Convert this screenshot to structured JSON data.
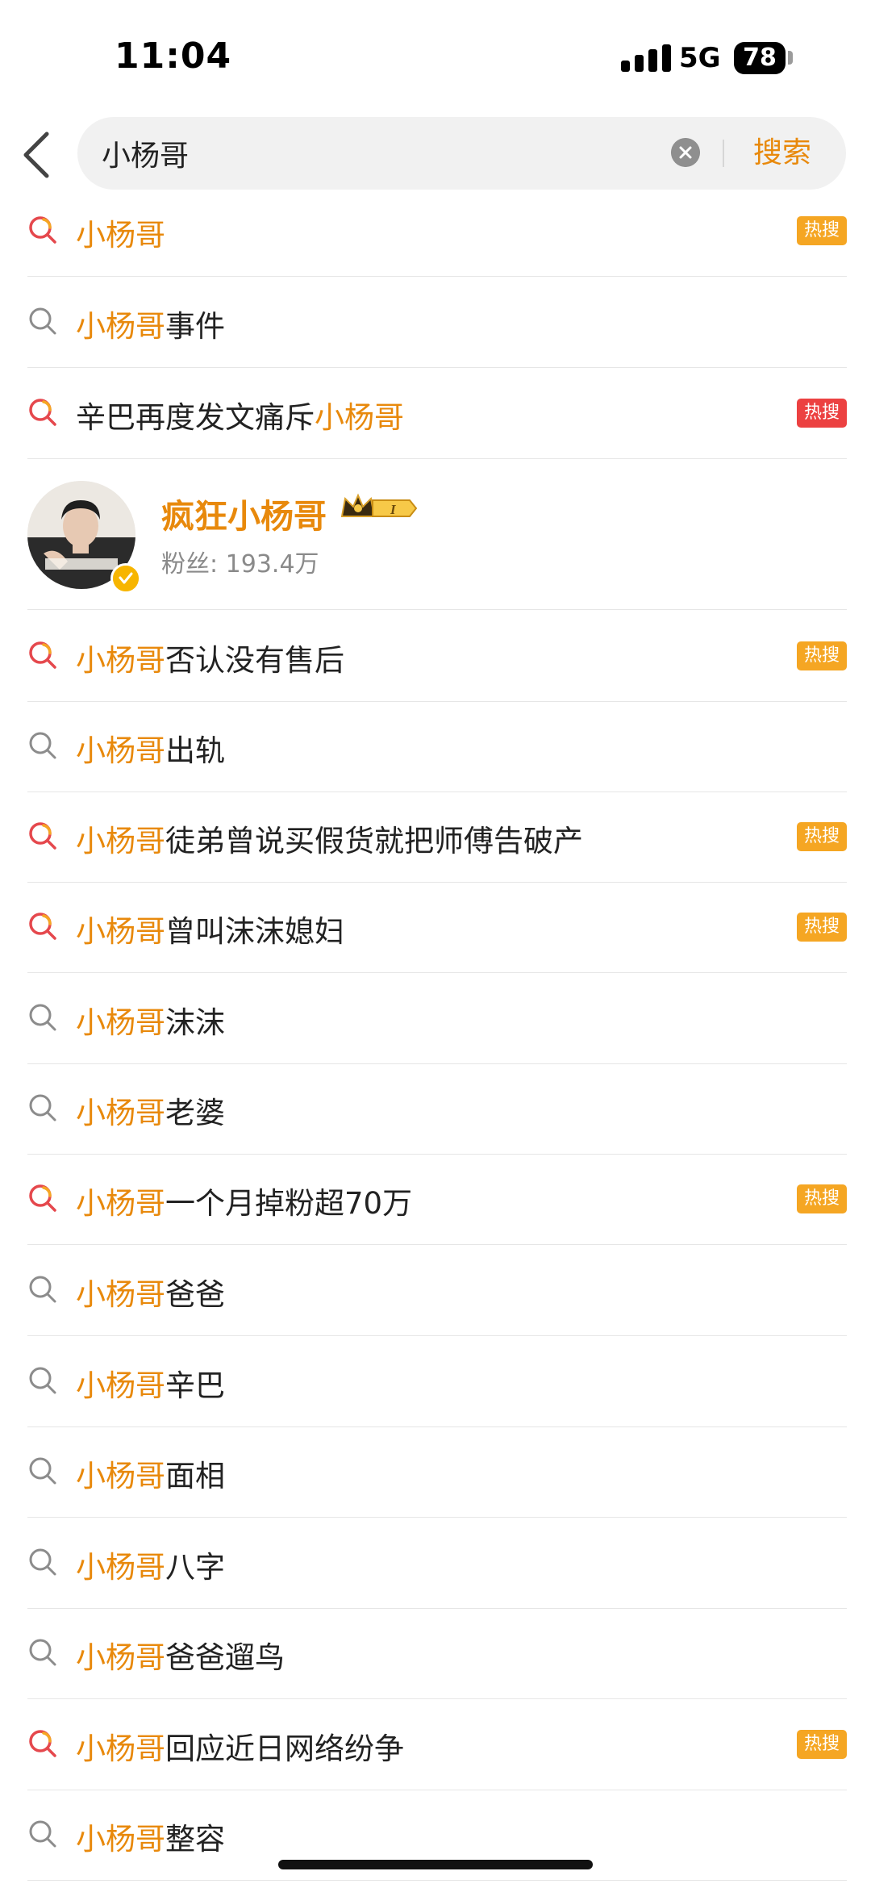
{
  "status_bar": {
    "time": "11:04",
    "network": "5G",
    "battery": "78"
  },
  "search": {
    "query": "小杨哥",
    "button_label": "搜索"
  },
  "user": {
    "name": "疯狂小杨哥",
    "fans_label": "粉丝:",
    "fans_value": "193.4万"
  },
  "badge_text": "热搜",
  "colors": {
    "accent": "#e8890c",
    "hot_orange": "#f5a623",
    "hot_red": "#ec4141",
    "hot_icon_red": "#e5484d"
  },
  "suggestions": [
    {
      "highlight": "小杨哥",
      "rest": "",
      "icon": "hot-search-icon",
      "badge": "orange"
    },
    {
      "highlight": "小杨哥",
      "rest": "事件",
      "icon": "search-icon",
      "badge": ""
    },
    {
      "prefix": "辛巴再度发文痛斥",
      "highlight": "小杨哥",
      "rest": "",
      "icon": "hot-search-icon",
      "badge": "red"
    },
    {
      "highlight": "小杨哥",
      "rest": "否认没有售后",
      "icon": "hot-search-icon",
      "badge": "orange"
    },
    {
      "highlight": "小杨哥",
      "rest": "出轨",
      "icon": "search-icon",
      "badge": ""
    },
    {
      "highlight": "小杨哥",
      "rest": "徒弟曾说买假货就把师傅告破产",
      "icon": "hot-search-icon",
      "badge": "orange"
    },
    {
      "highlight": "小杨哥",
      "rest": "曾叫沫沫媳妇",
      "icon": "hot-search-icon",
      "badge": "orange"
    },
    {
      "highlight": "小杨哥",
      "rest": "沫沫",
      "icon": "search-icon",
      "badge": ""
    },
    {
      "highlight": "小杨哥",
      "rest": "老婆",
      "icon": "search-icon",
      "badge": ""
    },
    {
      "highlight": "小杨哥",
      "rest": "一个月掉粉超70万",
      "icon": "hot-search-icon",
      "badge": "orange"
    },
    {
      "highlight": "小杨哥",
      "rest": "爸爸",
      "icon": "search-icon",
      "badge": ""
    },
    {
      "highlight": "小杨哥",
      "rest": "辛巴",
      "icon": "search-icon",
      "badge": ""
    },
    {
      "highlight": "小杨哥",
      "rest": "面相",
      "icon": "search-icon",
      "badge": ""
    },
    {
      "highlight": "小杨哥",
      "rest": "八字",
      "icon": "search-icon",
      "badge": ""
    },
    {
      "highlight": "小杨哥",
      "rest": "爸爸遛鸟",
      "icon": "search-icon",
      "badge": ""
    },
    {
      "highlight": "小杨哥",
      "rest": "回应近日网络纷争",
      "icon": "hot-search-icon",
      "badge": "orange"
    },
    {
      "highlight": "小杨哥",
      "rest": "整容",
      "icon": "search-icon",
      "badge": ""
    }
  ]
}
